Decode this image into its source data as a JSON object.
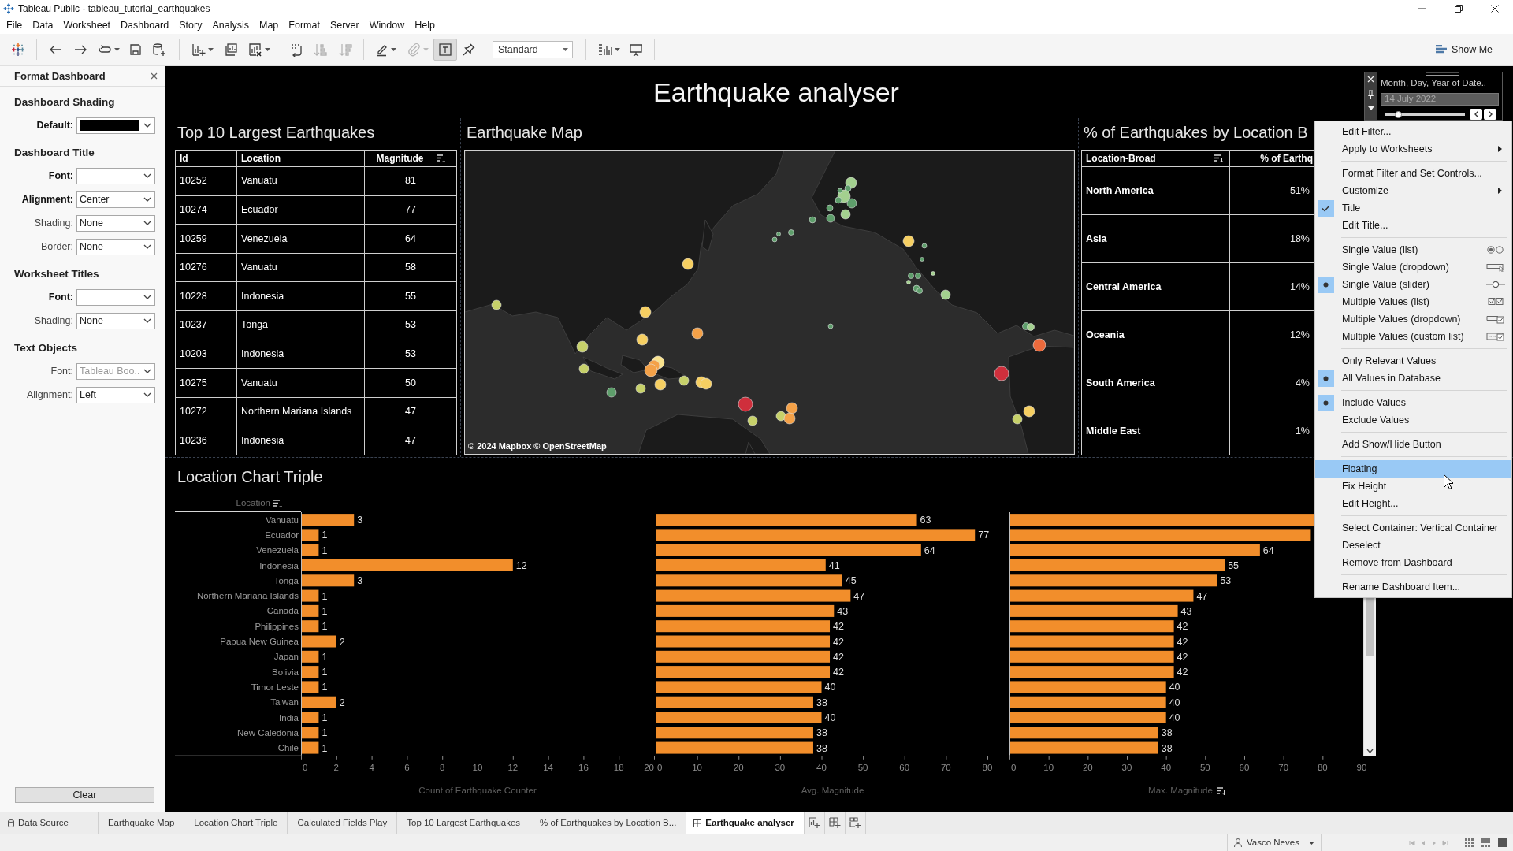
{
  "window": {
    "title": "Tableau Public - tableau_tutorial_earthquakes"
  },
  "menu_bar": [
    "File",
    "Data",
    "Worksheet",
    "Dashboard",
    "Story",
    "Analysis",
    "Map",
    "Format",
    "Server",
    "Window",
    "Help"
  ],
  "toolbar": {
    "buttons": [
      {
        "disabled": false,
        "pressed": false
      },
      {
        "disabled": false,
        "pressed": false
      },
      {
        "disabled": false,
        "pressed": false
      },
      {
        "disabled": false,
        "pressed": false
      },
      {
        "disabled": false,
        "pressed": false
      },
      {
        "disabled": false,
        "pressed": false
      },
      {
        "disabled": false,
        "pressed": false
      },
      {
        "disabled": false,
        "pressed": false
      },
      {
        "disabled": false,
        "pressed": false
      },
      {
        "disabled": false,
        "pressed": false
      },
      {
        "disabled": true,
        "pressed": false
      },
      {
        "disabled": true,
        "pressed": false
      },
      {
        "disabled": false,
        "pressed": false
      },
      {
        "disabled": true,
        "pressed": false
      },
      {
        "disabled": false,
        "pressed": true
      },
      {
        "disabled": false,
        "pressed": false
      },
      {
        "disabled": false,
        "pressed": false
      },
      {
        "disabled": false,
        "pressed": false
      }
    ],
    "view_mode": "Standard",
    "show_me": "Show Me"
  },
  "format_panel": {
    "title": "Format Dashboard",
    "sections": [
      {
        "heading": "Dashboard Shading",
        "fields": [
          {
            "label": "Default:",
            "bold": true,
            "kind": "color",
            "color": "#000000",
            "dimmed": false
          }
        ]
      },
      {
        "heading": "Dashboard Title",
        "fields": [
          {
            "label": "Font:",
            "bold": true,
            "kind": "select",
            "dimmed": false
          },
          {
            "label": "Alignment:",
            "bold": true,
            "kind": "select",
            "value": "Center",
            "dimmed": false
          },
          {
            "label": "Shading:",
            "bold": false,
            "kind": "select",
            "value": "None",
            "dimmed": false
          },
          {
            "label": "Border:",
            "bold": false,
            "kind": "select",
            "value": "None",
            "dimmed": false
          }
        ]
      },
      {
        "heading": "Worksheet Titles",
        "fields": [
          {
            "label": "Font:",
            "bold": true,
            "kind": "select",
            "dimmed": false
          },
          {
            "label": "Shading:",
            "bold": false,
            "kind": "select",
            "value": "None",
            "dimmed": false
          }
        ]
      },
      {
        "heading": "Text Objects",
        "fields": [
          {
            "label": "Font:",
            "bold": false,
            "kind": "select",
            "value": "Tableau Boo..",
            "dimmed": true
          },
          {
            "label": "Alignment:",
            "bold": false,
            "kind": "select",
            "value": "Left",
            "dimmed": false
          }
        ]
      }
    ],
    "clear_button": "Clear"
  },
  "dashboard": {
    "title": "Earthquake analyser",
    "top_earthquakes": {
      "title": "Top 10 Largest Earthquakes",
      "columns": [
        {
          "label": "Id",
          "sorted": false
        },
        {
          "label": "Location",
          "sorted": false
        },
        {
          "label": "Magnitude",
          "sorted": true
        }
      ],
      "rows": [
        [
          "10252",
          "Vanuatu",
          "81"
        ],
        [
          "10274",
          "Ecuador",
          "77"
        ],
        [
          "10259",
          "Venezuela",
          "64"
        ],
        [
          "10276",
          "Vanuatu",
          "58"
        ],
        [
          "10228",
          "Indonesia",
          "55"
        ],
        [
          "10237",
          "Tonga",
          "53"
        ],
        [
          "10203",
          "Indonesia",
          "53"
        ],
        [
          "10275",
          "Vanuatu",
          "50"
        ],
        [
          "10272",
          "Northern Mariana Islands",
          "47"
        ],
        [
          "10236",
          "Indonesia",
          "47"
        ]
      ]
    },
    "map": {
      "title": "Earthquake Map",
      "attribution": "© 2024 Mapbox © OpenStreetMap"
    },
    "share_by_location": {
      "title": "% of Earthquakes by Location B",
      "columns": [
        {
          "label": "Location-Broad",
          "sorted": true
        },
        {
          "label": "% of Earthq",
          "sorted": false
        }
      ],
      "rows": [
        [
          "North America",
          "51%"
        ],
        [
          "Asia",
          "18%"
        ],
        [
          "Central America",
          "14%"
        ],
        [
          "Oceania",
          "12%"
        ],
        [
          "South America",
          "4%"
        ],
        [
          "Middle East",
          "1%"
        ]
      ]
    },
    "location_chart": {
      "title": "Location Chart Triple",
      "row_header": {
        "label": "Location",
        "sorted": true
      },
      "charts": [
        {
          "sorted": false,
          "chart_data": {
            "type": "bar",
            "orientation": "horizontal",
            "xlabel": "Count of Earthquake Counter",
            "categories": [
              "Vanuatu",
              "Ecuador",
              "Venezuela",
              "Indonesia",
              "Tonga",
              "Northern Mariana Islands",
              "Canada",
              "Philippines",
              "Papua New Guinea",
              "Japan",
              "Bolivia",
              "Timor Leste",
              "Taiwan",
              "India",
              "New Caledonia",
              "Chile"
            ],
            "values": [
              3,
              1,
              1,
              12,
              3,
              1,
              1,
              1,
              2,
              1,
              1,
              1,
              2,
              1,
              1,
              1
            ],
            "xlim": [
              0,
              20
            ],
            "xticks": [
              0,
              2,
              4,
              6,
              8,
              10,
              12,
              14,
              16,
              18,
              20
            ],
            "data_labels": true
          }
        },
        {
          "sorted": false,
          "chart_data": {
            "type": "bar",
            "orientation": "horizontal",
            "xlabel": "Avg. Magnitude",
            "values": [
              63,
              77,
              64,
              41,
              45,
              47,
              43,
              42,
              42,
              42,
              42,
              40,
              38,
              40,
              38,
              38
            ],
            "xlim": [
              0,
              80
            ],
            "xticks": [
              0,
              10,
              20,
              30,
              40,
              50,
              60,
              70,
              80
            ],
            "data_labels": true
          }
        },
        {
          "sorted": true,
          "chart_data": {
            "type": "bar",
            "orientation": "horizontal",
            "xlabel": "Max. Magnitude",
            "values": [
              null,
              77,
              64,
              55,
              53,
              47,
              43,
              42,
              42,
              42,
              42,
              40,
              40,
              40,
              38,
              38
            ],
            "xlim": [
              0,
              90
            ],
            "xticks": [
              0,
              10,
              20,
              30,
              40,
              50,
              60,
              70,
              80,
              90
            ],
            "value_labels": [
              null,
              null,
              "64",
              "55",
              "53",
              "47",
              "43",
              "42",
              "42",
              "42",
              "42",
              "40",
              "40",
              "40",
              "38",
              "38"
            ]
          }
        }
      ]
    },
    "filter": {
      "title": "Month, Day, Year of Date..",
      "value": "14 July 2022",
      "level": 0.16
    }
  },
  "context_menu": {
    "sections": [
      [
        {
          "label": "Edit Filter...",
          "kind": "command",
          "checked": false,
          "highlighted": false
        },
        {
          "label": "Apply to Worksheets",
          "kind": "submenu",
          "checked": false,
          "highlighted": false
        }
      ],
      [
        {
          "label": "Format Filter and Set Controls...",
          "kind": "command",
          "checked": false,
          "highlighted": false
        },
        {
          "label": "Customize",
          "kind": "submenu",
          "checked": false,
          "highlighted": false
        },
        {
          "label": "Title",
          "kind": "toggle",
          "checked": true,
          "highlighted": false
        },
        {
          "label": "Edit Title...",
          "kind": "command",
          "checked": false,
          "highlighted": false
        }
      ],
      [
        {
          "label": "Single Value (list)",
          "kind": "display-mode",
          "checked": false,
          "highlighted": false
        },
        {
          "label": "Single Value (dropdown)",
          "kind": "display-mode",
          "checked": false,
          "highlighted": false
        },
        {
          "label": "Single Value (slider)",
          "kind": "display-mode",
          "checked": true,
          "highlighted": false
        },
        {
          "label": "Multiple Values (list)",
          "kind": "display-mode",
          "checked": false,
          "highlighted": false
        },
        {
          "label": "Multiple Values (dropdown)",
          "kind": "display-mode",
          "checked": false,
          "highlighted": false
        },
        {
          "label": "Multiple Values (custom list)",
          "kind": "display-mode",
          "checked": false,
          "highlighted": false
        }
      ],
      [
        {
          "label": "Only Relevant Values",
          "kind": "radio",
          "checked": false,
          "highlighted": false
        },
        {
          "label": "All Values in Database",
          "kind": "radio",
          "checked": true,
          "highlighted": false
        }
      ],
      [
        {
          "label": "Include Values",
          "kind": "radio",
          "checked": true,
          "highlighted": false
        },
        {
          "label": "Exclude Values",
          "kind": "radio",
          "checked": false,
          "highlighted": false
        }
      ],
      [
        {
          "label": "Add Show/Hide Button",
          "kind": "command",
          "checked": false,
          "highlighted": false
        }
      ],
      [
        {
          "label": "Floating",
          "kind": "toggle",
          "checked": false,
          "highlighted": true
        },
        {
          "label": "Fix Height",
          "kind": "toggle",
          "checked": false,
          "highlighted": false
        },
        {
          "label": "Edit Height...",
          "kind": "command",
          "checked": false,
          "highlighted": false
        }
      ],
      [
        {
          "label": "Select Container: Vertical Container",
          "kind": "command",
          "checked": false,
          "highlighted": false
        },
        {
          "label": "Deselect",
          "kind": "command",
          "checked": false,
          "highlighted": false
        },
        {
          "label": "Remove from Dashboard",
          "kind": "command",
          "checked": false,
          "highlighted": false
        }
      ],
      [
        {
          "label": "Rename Dashboard Item...",
          "kind": "command",
          "checked": false,
          "highlighted": false
        }
      ]
    ]
  },
  "sheet_tabs": [
    {
      "label": "Data Source",
      "kind": "datasource",
      "selected": false
    },
    {
      "label": "Earthquake Map",
      "kind": "sheet",
      "selected": false
    },
    {
      "label": "Location Chart Triple",
      "kind": "sheet",
      "selected": false
    },
    {
      "label": "Calculated Fields Play",
      "kind": "sheet",
      "selected": false
    },
    {
      "label": "Top 10 Largest Earthquakes",
      "kind": "sheet",
      "selected": false
    },
    {
      "label": "% of Earthquakes by Location B...",
      "kind": "sheet",
      "selected": false
    },
    {
      "label": "Earthquake analyser",
      "kind": "dashboard",
      "selected": true
    }
  ],
  "status_bar": {
    "user": "Vasco Neves"
  }
}
